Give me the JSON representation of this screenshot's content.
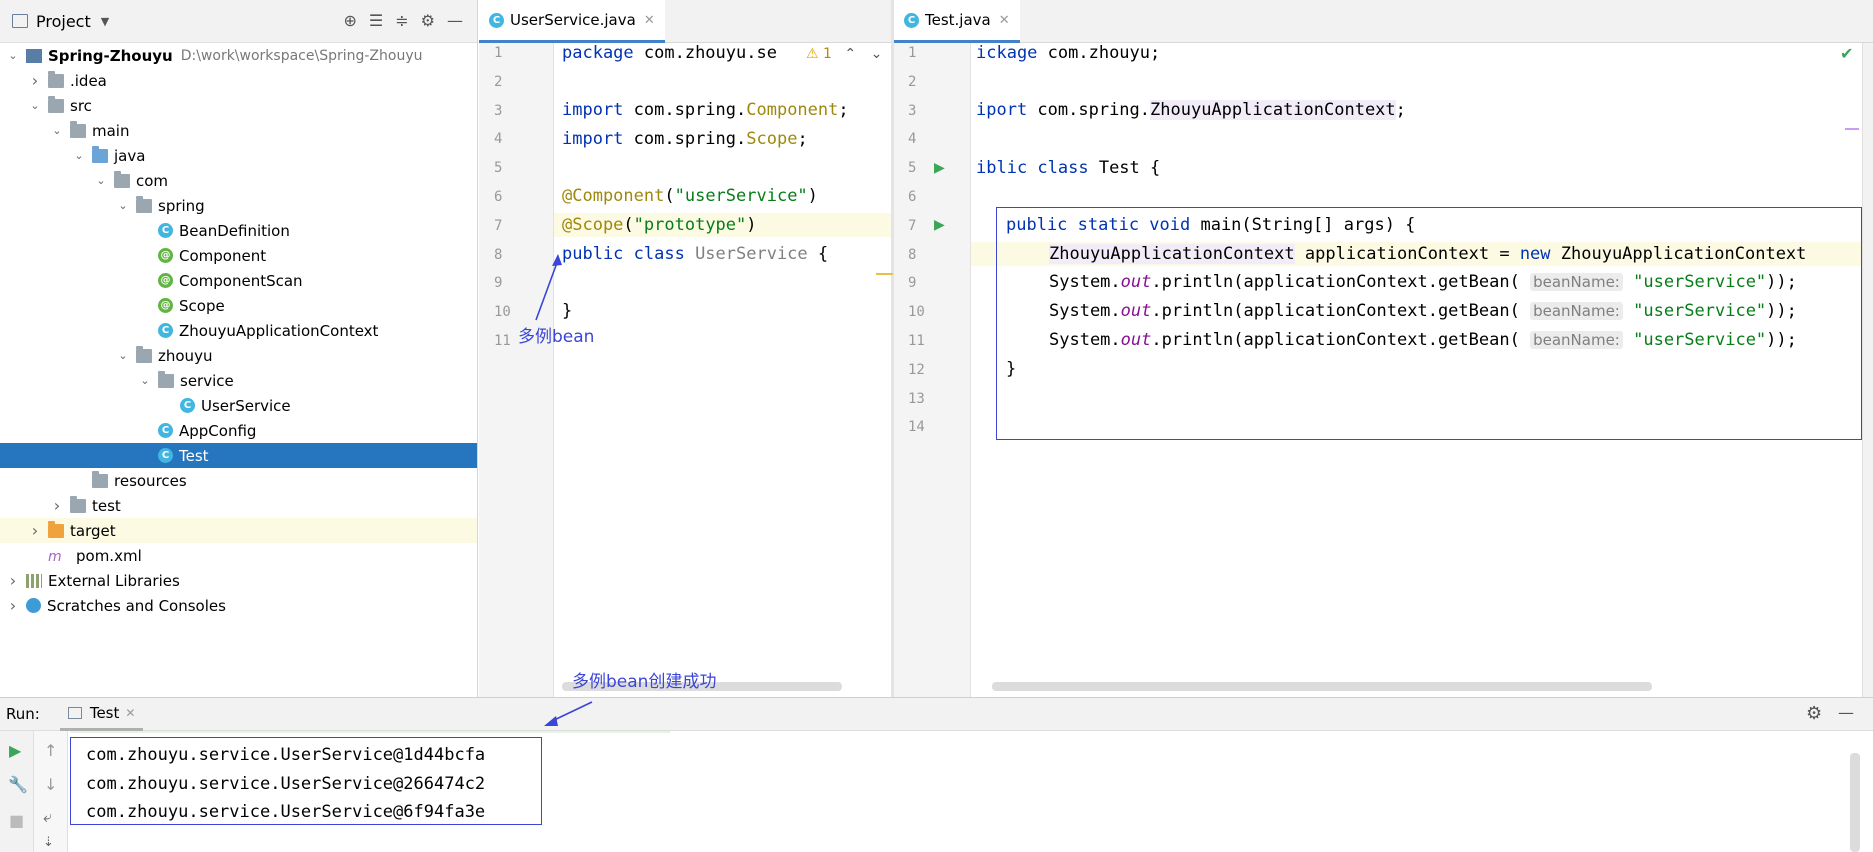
{
  "project_panel": {
    "title": "Project",
    "tree": [
      {
        "label": "Spring-Zhouyu",
        "path": "D:\\work\\workspace\\Spring-Zhouyu",
        "icon": "module-icon",
        "depth": 0,
        "arrow": "down"
      },
      {
        "label": ".idea",
        "icon": "folder-icon",
        "depth": 1,
        "arrow": "right"
      },
      {
        "label": "src",
        "icon": "folder-icon",
        "depth": 1,
        "arrow": "down"
      },
      {
        "label": "main",
        "icon": "folder-icon",
        "depth": 2,
        "arrow": "down"
      },
      {
        "label": "java",
        "icon": "source-folder-icon",
        "depth": 3,
        "arrow": "down"
      },
      {
        "label": "com",
        "icon": "package-icon",
        "depth": 4,
        "arrow": "down"
      },
      {
        "label": "spring",
        "icon": "package-icon",
        "depth": 5,
        "arrow": "down"
      },
      {
        "label": "BeanDefinition",
        "icon": "class-icon",
        "depth": 6
      },
      {
        "label": "Component",
        "icon": "annotation-icon",
        "depth": 6
      },
      {
        "label": "ComponentScan",
        "icon": "annotation-icon",
        "depth": 6
      },
      {
        "label": "Scope",
        "icon": "annotation-icon",
        "depth": 6
      },
      {
        "label": "ZhouyuApplicationContext",
        "icon": "class-icon",
        "depth": 6
      },
      {
        "label": "zhouyu",
        "icon": "package-icon",
        "depth": 5,
        "arrow": "down"
      },
      {
        "label": "service",
        "icon": "package-icon",
        "depth": 6,
        "arrow": "down"
      },
      {
        "label": "UserService",
        "icon": "class-icon",
        "depth": 7
      },
      {
        "label": "AppConfig",
        "icon": "class-icon",
        "depth": 6
      },
      {
        "label": "Test",
        "icon": "class-icon",
        "depth": 6,
        "selected": true
      },
      {
        "label": "resources",
        "icon": "folder-icon",
        "depth": 3
      },
      {
        "label": "test",
        "icon": "folder-icon",
        "depth": 2,
        "arrow": "right"
      },
      {
        "label": "target",
        "icon": "excluded-folder-icon",
        "depth": 1,
        "arrow": "right",
        "highlight": true
      },
      {
        "label": "pom.xml",
        "icon": "maven-icon",
        "depth": 1
      },
      {
        "label": "External Libraries",
        "icon": "library-icon",
        "depth": 0,
        "arrow": "right"
      },
      {
        "label": "Scratches and Consoles",
        "icon": "scratch-icon",
        "depth": 0,
        "arrow": "right"
      }
    ]
  },
  "editor_left": {
    "tab": "UserService.java",
    "warning_count": "1",
    "line_numbers": [
      "1",
      "2",
      "3",
      "4",
      "5",
      "6",
      "7",
      "8",
      "9",
      "10",
      "11"
    ],
    "lines": {
      "l1_kw": "package",
      "l1_rest": " com.zhouyu.se",
      "l3_kw": "import",
      "l3_pkg": " com.spring.",
      "l3_cls": "Component",
      "l3_end": ";",
      "l4_kw": "import",
      "l4_pkg": " com.spring.",
      "l4_cls": "Scope",
      "l4_end": ";",
      "l6_ann": "@Component",
      "l6_open": "(",
      "l6_str": "\"userService\"",
      "l6_close": ")",
      "l7_ann": "@Scope",
      "l7_open": "(",
      "l7_str": "\"prototype\"",
      "l7_close": ")",
      "l8_kw": "public class",
      "l8_name": " UserService",
      "l8_end": " {",
      "l10": "}"
    },
    "annotation": "多例bean"
  },
  "editor_right": {
    "tab": "Test.java",
    "line_numbers": [
      "1",
      "2",
      "3",
      "4",
      "5",
      "6",
      "7",
      "8",
      "9",
      "10",
      "11",
      "12",
      "13",
      "14"
    ],
    "lines": {
      "l1_kw": "ickage",
      "l1_rest": " com.zhouyu;",
      "l3_kw": "iport",
      "l3_pkg": " com.spring.",
      "l3_cls": "ZhouyuApplicationContext",
      "l3_end": ";",
      "l5_kw": "iblic class",
      "l5_rest": " Test {",
      "l7_kw": "public static void",
      "l7_rest": " main(String[] args) {",
      "l8_type": "ZhouyuApplicationContext",
      "l8_var": " applicationContext = ",
      "l8_new": "new",
      "l8_cls": " ZhouyuApplicationContext",
      "println_prefix": "System.",
      "println_out": "out",
      "println_mid": ".println(applicationContext.getBean(",
      "hint": "beanName:",
      "println_str": "\"userService\"",
      "println_end": "));",
      "l12": "}"
    }
  },
  "run_panel": {
    "label": "Run:",
    "tab": "Test",
    "output": [
      "com.zhouyu.service.UserService@1d44bcfa",
      "com.zhouyu.service.UserService@266474c2",
      "com.zhouyu.service.UserService@6f94fa3e"
    ],
    "annotation": "多例bean创建成功"
  },
  "colors": {
    "accent": "#2675bf",
    "annotation": "#3b45d6",
    "keyword": "#0033b3",
    "string": "#067d17"
  }
}
